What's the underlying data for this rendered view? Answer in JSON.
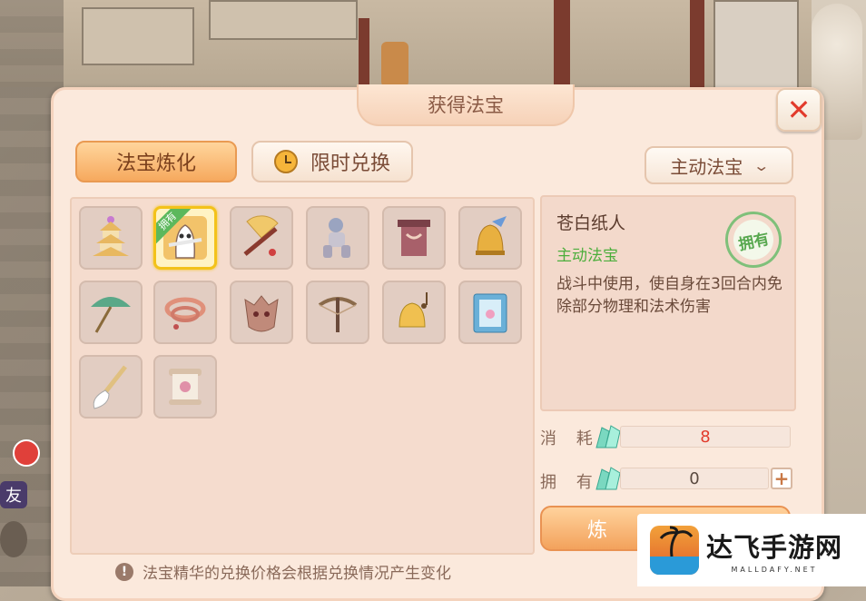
{
  "window": {
    "title": "获得法宝",
    "close_glyph": "✕"
  },
  "tabs": [
    {
      "label": "法宝炼化",
      "active": true
    },
    {
      "label": "限时兑换",
      "active": false,
      "icon": "clock-icon"
    }
  ],
  "filter": {
    "selected": "主动法宝",
    "chevron": "⌄"
  },
  "grid": {
    "owned_badge": "拥有",
    "items": [
      {
        "icon": "pagoda-icon",
        "selected": false,
        "owned": false
      },
      {
        "icon": "paper-ghost-icon",
        "selected": true,
        "owned": true
      },
      {
        "icon": "fan-sword-icon",
        "selected": false,
        "owned": false
      },
      {
        "icon": "puppet-icon",
        "selected": false,
        "owned": false
      },
      {
        "icon": "drum-tower-icon",
        "selected": false,
        "owned": false
      },
      {
        "icon": "bell-icon",
        "selected": false,
        "owned": false
      },
      {
        "icon": "umbrella-icon",
        "selected": false,
        "owned": false
      },
      {
        "icon": "rope-icon",
        "selected": false,
        "owned": false
      },
      {
        "icon": "demon-mask-icon",
        "selected": false,
        "owned": false
      },
      {
        "icon": "crossbow-icon",
        "selected": false,
        "owned": false
      },
      {
        "icon": "music-bell-icon",
        "selected": false,
        "owned": false
      },
      {
        "icon": "book-icon",
        "selected": false,
        "owned": false
      },
      {
        "icon": "brush-icon",
        "selected": false,
        "owned": false
      },
      {
        "icon": "scroll-icon",
        "selected": false,
        "owned": false
      }
    ]
  },
  "detail": {
    "name": "苍白纸人",
    "type": "主动法宝",
    "description": "战斗中使用，使自身在3回合内免除部分物理和法术伤害",
    "stamp": "拥有"
  },
  "cost": {
    "label": "消 耗",
    "value": "8",
    "icon": "jade-crystal-icon"
  },
  "owned": {
    "label": "拥 有",
    "value": "0",
    "icon": "jade-crystal-icon",
    "plus": "+"
  },
  "refine_button": {
    "label": "炼"
  },
  "notice": {
    "icon": "exclamation-icon",
    "glyph": "!",
    "text": "法宝精华的兑换价格会根据兑换情况产生变化"
  },
  "watermark": {
    "text": "达飞手游网",
    "url": "MALLDAFY.NET"
  },
  "hud": {
    "friend_label": "友"
  },
  "colors": {
    "accent": "#f6a95e",
    "owned_green": "#4cae3c",
    "cost_red": "#e23b2c"
  }
}
